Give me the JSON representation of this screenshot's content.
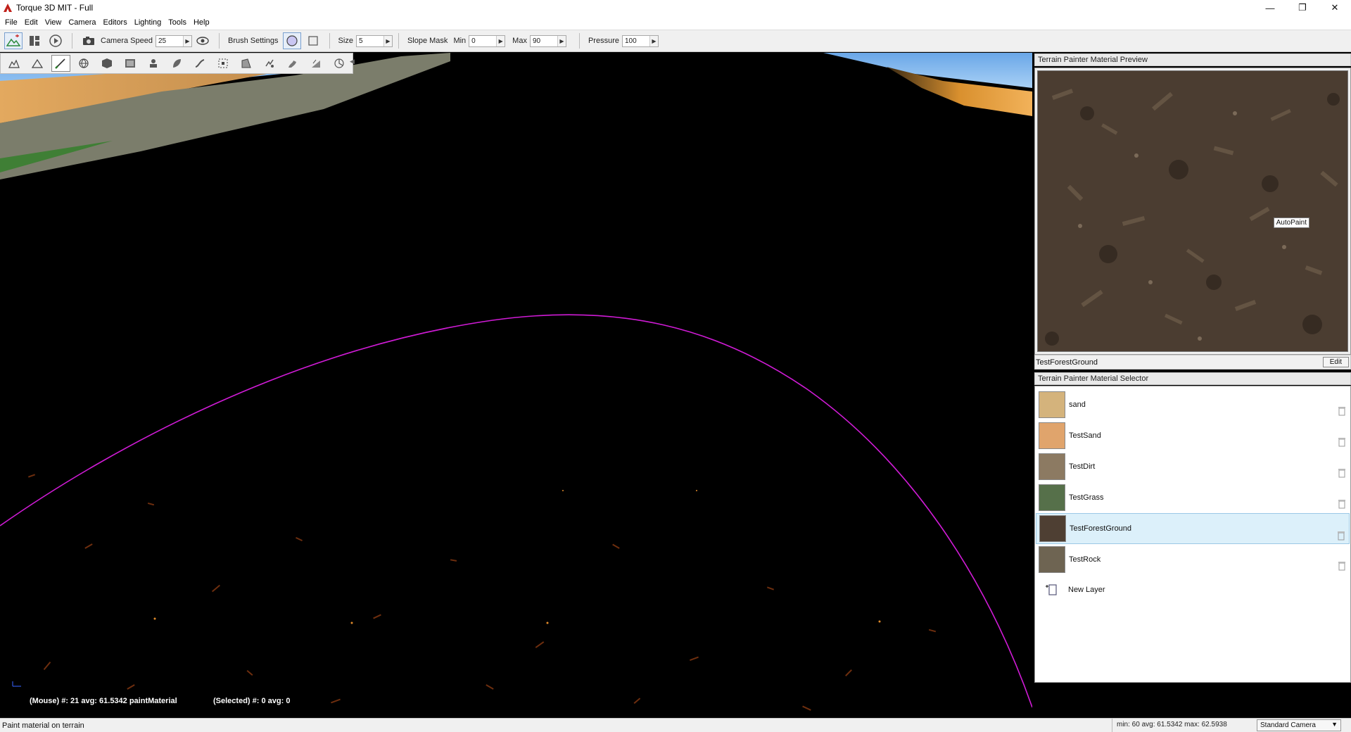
{
  "window": {
    "title": "Torque 3D MIT - Full",
    "minimize": "—",
    "restore": "❐",
    "close": "✕"
  },
  "menu": [
    "File",
    "Edit",
    "View",
    "Camera",
    "Editors",
    "Lighting",
    "Tools",
    "Help"
  ],
  "toolbar": {
    "camera_speed_label": "Camera Speed",
    "camera_speed_value": "25",
    "brush_settings_label": "Brush Settings",
    "size_label": "Size",
    "size_value": "5",
    "slope_mask_label": "Slope Mask",
    "min_label": "Min",
    "min_value": "0",
    "max_label": "Max",
    "max_value": "90",
    "pressure_label": "Pressure",
    "pressure_value": "100"
  },
  "palette_tools": [
    "terrain-raise-icon",
    "terrain-lower-icon",
    "paint-brush-icon",
    "globe-icon",
    "cube-icon",
    "heightmap-icon",
    "stamp-icon",
    "leaf-icon",
    "smooth-icon",
    "select-box-icon",
    "flatten-icon",
    "noise-icon",
    "erosion-icon",
    "slope-icon",
    "orbit-icon"
  ],
  "viewport": {
    "mouse_status": "(Mouse) #: 21  avg: 61.5342 paintMaterial",
    "selected_status": "(Selected) #: 0  avg: 0"
  },
  "preview": {
    "header": "Terrain Painter Material Preview",
    "autopaint_label": "AutoPaint",
    "material_name": "TestForestGround",
    "edit_label": "Edit"
  },
  "selector": {
    "header": "Terrain Painter Material Selector",
    "materials": [
      {
        "name": "sand",
        "color": "#d4b37c"
      },
      {
        "name": "TestSand",
        "color": "#e0a46c"
      },
      {
        "name": "TestDirt",
        "color": "#8c7a62"
      },
      {
        "name": "TestGrass",
        "color": "#56704a"
      },
      {
        "name": "TestForestGround",
        "color": "#4e3f33"
      },
      {
        "name": "TestRock",
        "color": "#6e6452"
      }
    ],
    "selected_index": 4,
    "new_layer_label": "New Layer"
  },
  "statusbar": {
    "message": "Paint material on terrain",
    "stats": "min: 60  avg: 61.5342  max: 62.5938",
    "camera_mode": "Standard Camera"
  },
  "colors": {
    "brush_outline": "#d01bd6",
    "selected_row": "#dcf0fa"
  }
}
